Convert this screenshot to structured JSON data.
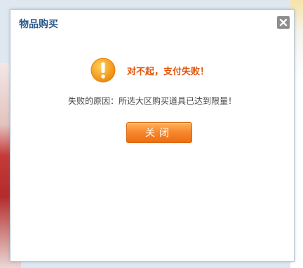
{
  "dialog": {
    "title": "物品购买",
    "status_message": "对不起，支付失败！",
    "reason_text": "失败的原因：所选大区购买道具已达到限量！",
    "close_button_label": "关闭"
  },
  "icons": {
    "status": "warning-exclamation-icon",
    "close": "close-x-icon"
  },
  "colors": {
    "title": "#2a5a8a",
    "status_text": "#e0560f",
    "button": "#f6862a",
    "warning_icon": "#f7a21b"
  }
}
